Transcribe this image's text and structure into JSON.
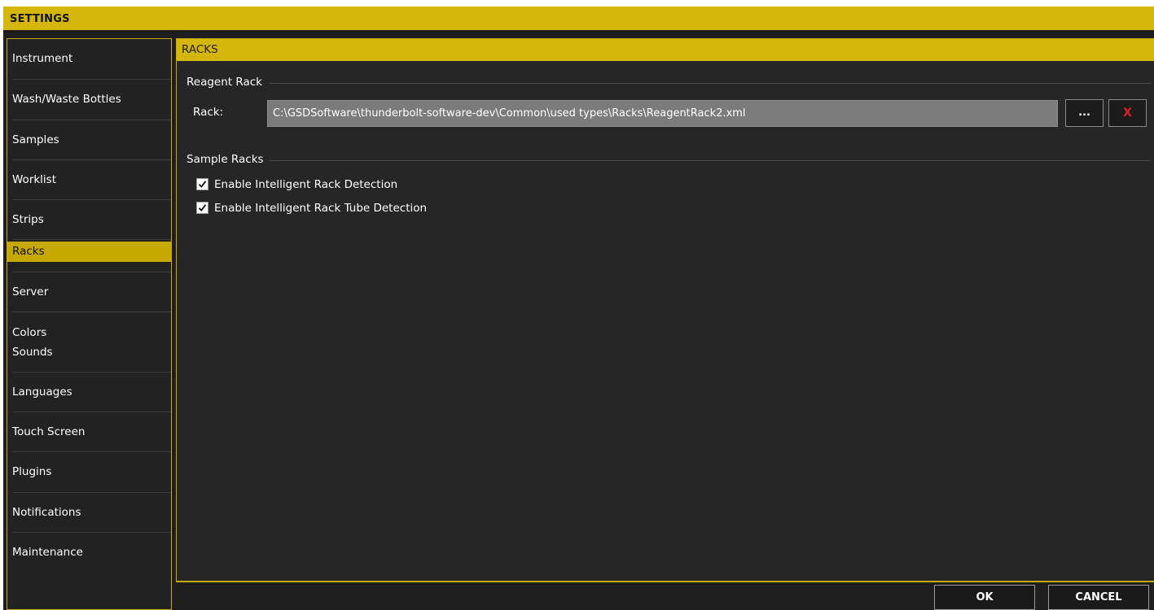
{
  "window": {
    "title": "SETTINGS"
  },
  "sidebar": {
    "items": [
      {
        "label": "Instrument"
      },
      {
        "label": "Wash/Waste Bottles"
      },
      {
        "label": "Samples"
      },
      {
        "label": "Worklist"
      },
      {
        "label": "Strips"
      },
      {
        "label": "Racks",
        "active": true
      },
      {
        "label": "Server"
      },
      {
        "label": "Colors",
        "label2": "Sounds"
      },
      {
        "label": "Languages"
      },
      {
        "label": "Touch Screen"
      },
      {
        "label": "Plugins"
      },
      {
        "label": "Notifications"
      },
      {
        "label": "Maintenance"
      }
    ]
  },
  "main": {
    "header": "RACKS",
    "reagent_group": {
      "title": "Reagent Rack",
      "rack_label": "Rack:",
      "rack_path": "C:\\GSDSoftware\\thunderbolt-software-dev\\Common\\used types\\Racks\\ReagentRack2.xml",
      "browse_label": "...",
      "clear_label": "X"
    },
    "sample_group": {
      "title": "Sample Racks",
      "checkboxes": [
        {
          "label": "Enable Intelligent Rack Detection",
          "checked": true
        },
        {
          "label": "Enable Intelligent Rack Tube Detection",
          "checked": true
        }
      ]
    }
  },
  "footer": {
    "ok_label": "OK",
    "cancel_label": "CANCEL"
  },
  "colors": {
    "accent": "#d4b70a",
    "background": "#1f1f1f",
    "panel": "#262626",
    "field": "#7b7b7b",
    "danger": "#e02020"
  }
}
